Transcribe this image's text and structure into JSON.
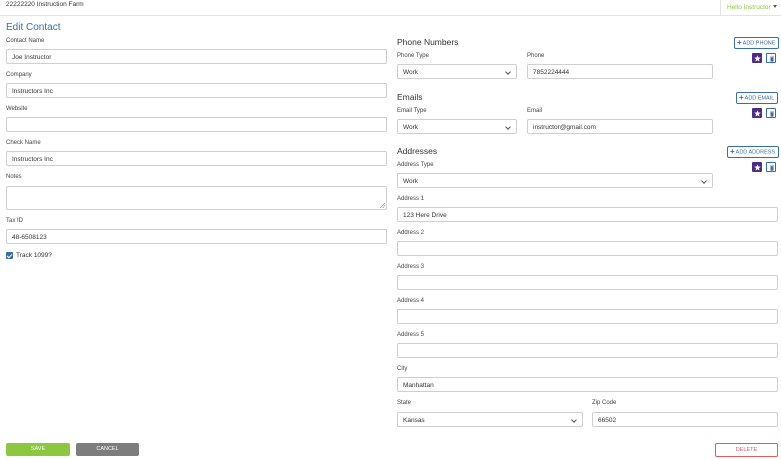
{
  "header": {
    "farm_name": "22222220 Instruction Farm",
    "user_greeting": "Hello Instructor"
  },
  "page": {
    "title": "Edit Contact"
  },
  "contact": {
    "contact_name_label": "Contact Name",
    "contact_name_value": "Joe Instructor",
    "company_label": "Company",
    "company_value": "Instructors Inc",
    "website_label": "Website",
    "website_value": "",
    "check_name_label": "Check Name",
    "check_name_value": "Instructors Inc",
    "notes_label": "Notes",
    "notes_value": "",
    "tax_id_label": "Tax ID",
    "tax_id_value": "48-6508123",
    "track_1099_label": "Track 1099?",
    "track_1099_checked": true
  },
  "phones": {
    "title": "Phone Numbers",
    "add_label": "ADD PHONE",
    "type_label": "Phone Type",
    "type_value": "Work",
    "number_label": "Phone",
    "number_value": "7852224444"
  },
  "emails": {
    "title": "Emails",
    "add_label": "ADD EMAIL",
    "type_label": "Email Type",
    "type_value": "Work",
    "email_label": "Email",
    "email_value": "instructor@gmail.com"
  },
  "addresses": {
    "title": "Addresses",
    "add_label": "ADD ADDRESS",
    "type_label": "Address Type",
    "type_value": "Work",
    "address1_label": "Address 1",
    "address1_value": "123 Here Drive",
    "address2_label": "Address 2",
    "address2_value": "",
    "address3_label": "Address 3",
    "address3_value": "",
    "address4_label": "Address 4",
    "address4_value": "",
    "address5_label": "Address 5",
    "address5_value": "",
    "city_label": "City",
    "city_value": "Manhattan",
    "state_label": "State",
    "state_value": "Kansas",
    "zip_label": "Zip Code",
    "zip_value": "66502"
  },
  "actions": {
    "save_label": "SAVE",
    "cancel_label": "CANCEL",
    "delete_label": "DELETE"
  },
  "colors": {
    "brand_green": "#8dc63f",
    "title_blue": "#3b6fa1",
    "primary_purple": "#4b2e83",
    "cancel_gray": "#7d7d7d",
    "danger_red": "#e05a5a"
  }
}
